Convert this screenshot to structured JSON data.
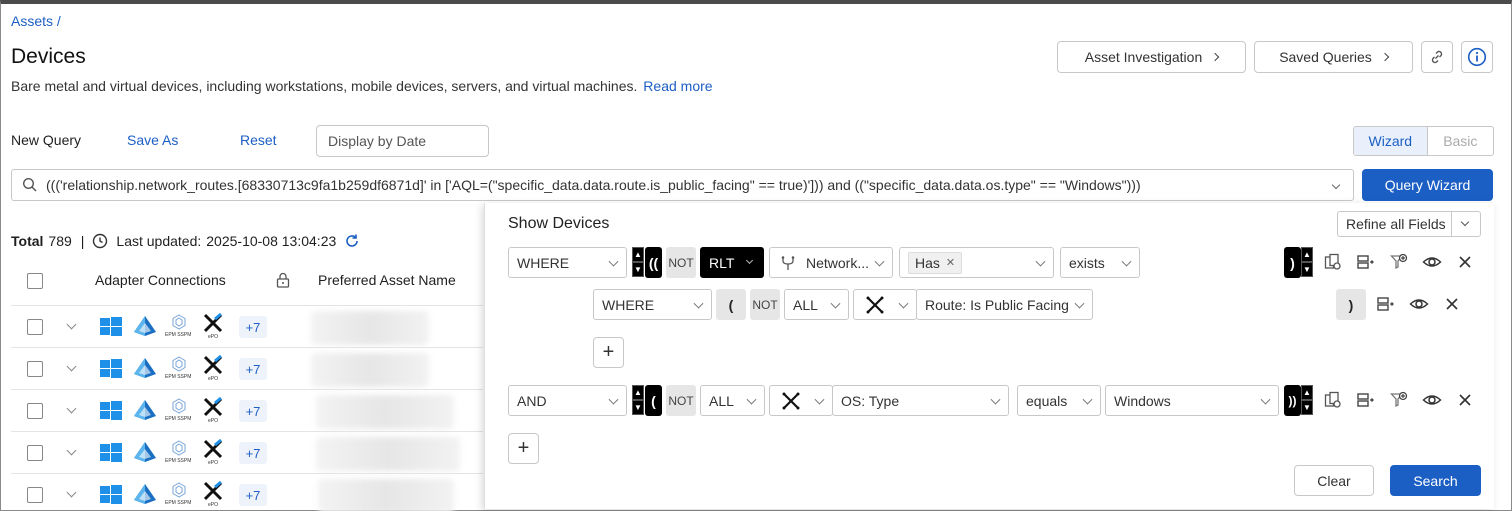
{
  "breadcrumb": "Assets /",
  "page": {
    "title": "Devices",
    "description": "Bare metal and virtual devices, including workstations, mobile devices, servers, and virtual machines.",
    "read_more": "Read more"
  },
  "header_buttons": {
    "asset_investigation": "Asset Investigation",
    "saved_queries": "Saved Queries"
  },
  "toolbar": {
    "new_query": "New Query",
    "save_as": "Save As",
    "reset": "Reset",
    "display_by_date_placeholder": "Display by Date",
    "wizard": "Wizard",
    "basic": "Basic"
  },
  "query": {
    "text": "((('relationship.network_routes.[68330713c9fa1b259df6871d]' in ['AQL=(\"specific_data.data.route.is_public_facing\" == true)'])) and ((\"specific_data.data.os.type\" == \"Windows\")))",
    "query_wizard_button": "Query Wizard"
  },
  "summary": {
    "total_label": "Total",
    "total_value": "789",
    "separator": "|",
    "last_updated_label": "Last updated:",
    "last_updated_value": "2025-10-08 13:04:23"
  },
  "table": {
    "columns": [
      "Adapter Connections",
      "Preferred Asset Name"
    ],
    "rows": [
      {
        "more": "+7"
      },
      {
        "more": "+7"
      },
      {
        "more": "+7"
      },
      {
        "more": "+7"
      },
      {
        "more": "+7"
      }
    ],
    "adapter_labels": {
      "epm": "EPM SSPM",
      "epo": "ePO"
    }
  },
  "wizard": {
    "title": "Show Devices",
    "refine_all_fields": "Refine all Fields",
    "row1": {
      "logic": "WHERE",
      "open_paren": "((",
      "not": "NOT",
      "rlt": "RLT",
      "field": "Network...",
      "tag": "Has",
      "operator": "exists",
      "close_paren": ")"
    },
    "subrow": {
      "logic": "WHERE",
      "open_paren": "(",
      "not": "NOT",
      "scope": "ALL",
      "field": "Route: Is Public Facing",
      "close_paren": ")"
    },
    "row2": {
      "logic": "AND",
      "open_paren": "(",
      "not": "NOT",
      "scope": "ALL",
      "field": "OS: Type",
      "operator": "equals",
      "value": "Windows",
      "close_paren": "))"
    },
    "add": "+",
    "clear": "Clear",
    "search": "Search"
  },
  "colors": {
    "primary": "#1c5fc4",
    "black_box": "#000000",
    "windows_blue": "#1e90e8",
    "azure_blue": "#1a6fc2"
  }
}
